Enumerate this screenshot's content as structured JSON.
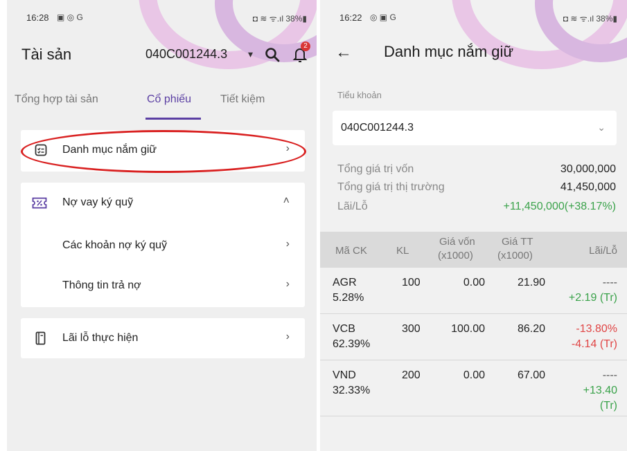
{
  "left": {
    "status": {
      "time": "16:28",
      "icons_left": "▣ ◎ G",
      "icons_right": "◘ ≋ ᯤ.ıl 38%▮"
    },
    "appbar": {
      "title": "Tài sản",
      "account": "040C001244.3",
      "caret": "▾",
      "notification_count": "2"
    },
    "tabs": [
      {
        "label": "Tổng hợp tài sản",
        "active": false
      },
      {
        "label": "Cổ phiếu",
        "active": true
      },
      {
        "label": "Tiết kiệm",
        "active": false
      }
    ],
    "menu": {
      "portfolio": {
        "label": "Danh mục nắm giữ",
        "chevron": "›"
      },
      "margin": {
        "label": "Nợ vay ký quỹ",
        "chevron": "˄",
        "items": [
          {
            "label": "Các khoản nợ ký quỹ",
            "chevron": "›"
          },
          {
            "label": "Thông tin trả nợ",
            "chevron": "›"
          }
        ]
      },
      "realized": {
        "label": "Lãi lỗ thực hiện",
        "chevron": "›"
      }
    }
  },
  "right": {
    "status": {
      "time": "16:22",
      "icons_left": "◎ ▣ G",
      "icons_right": "◘ ≋ ᯤ.ıl 38%▮"
    },
    "appbar": {
      "back": "←",
      "title": "Danh mục nắm giữ"
    },
    "subaccount": {
      "label": "Tiểu khoản",
      "value": "040C001244.3",
      "dropdown": "⌄"
    },
    "summary": [
      {
        "label": "Tổng giá trị vốn",
        "value": "30,000,000",
        "tone": "normal"
      },
      {
        "label": "Tổng giá trị thị trường",
        "value": "41,450,000",
        "tone": "normal"
      },
      {
        "label": "Lãi/Lỗ",
        "value": "+11,450,000(+38.17%)",
        "tone": "green"
      }
    ],
    "table": {
      "headers": {
        "code": "Mã CK",
        "qty": "KL",
        "cost_1": "Giá vốn",
        "cost_2": "(x1000)",
        "market_1": "Giá TT",
        "market_2": "(x1000)",
        "pl": "Lãi/Lỗ"
      },
      "rows": [
        {
          "code": "AGR",
          "weight": "5.28%",
          "qty": "100",
          "cost": "0.00",
          "market": "21.90",
          "pl_1": "----",
          "pl_2": "+2.19 (Tr)",
          "pl_3": "",
          "tone": "green"
        },
        {
          "code": "VCB",
          "weight": "62.39%",
          "qty": "300",
          "cost": "100.00",
          "market": "86.20",
          "pl_1": "-13.80%",
          "pl_2": "-4.14 (Tr)",
          "pl_3": "",
          "tone": "red"
        },
        {
          "code": "VND",
          "weight": "32.33%",
          "qty": "200",
          "cost": "0.00",
          "market": "67.00",
          "pl_1": "----",
          "pl_2": "+13.40",
          "pl_3": "(Tr)",
          "tone": "green"
        }
      ]
    }
  },
  "colors": {
    "accent": "#5b3fa3",
    "highlight": "#d92121",
    "positive": "#3aa24a",
    "negative": "#e04444",
    "badge": "#d93636"
  }
}
